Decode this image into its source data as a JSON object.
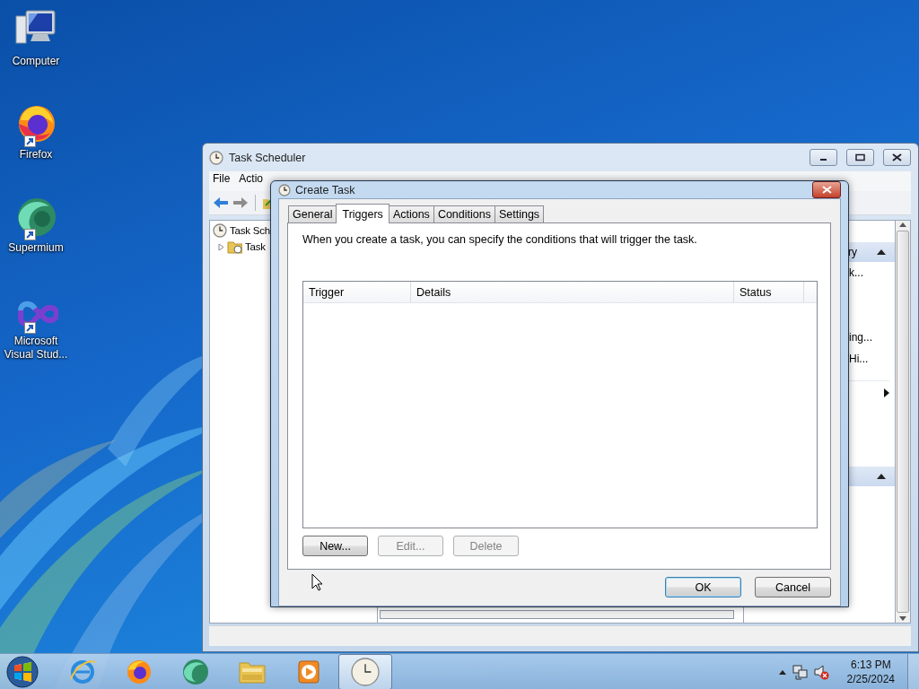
{
  "desktop_icons": [
    {
      "label": "Computer",
      "kind": "computer",
      "shortcut": false
    },
    {
      "label": "Firefox",
      "kind": "firefox",
      "shortcut": true
    },
    {
      "label": "Supermium",
      "kind": "supermium",
      "shortcut": true
    },
    {
      "label": "Microsoft Visual Stud...",
      "kind": "vs",
      "shortcut": true
    }
  ],
  "task_scheduler": {
    "title": "Task Scheduler",
    "menu": [
      {
        "label": "File"
      },
      {
        "label": "Actio"
      }
    ],
    "tree": [
      {
        "label": "Task Sch",
        "children": [
          {
            "label": "Task",
            "expanded": false
          }
        ]
      }
    ],
    "actions_pane": {
      "sections": [
        {
          "header": "ry",
          "expanded": true,
          "groups": [
            [
              "k..."
            ],
            [
              "ing...",
              "Hi..."
            ]
          ],
          "submenu": true
        },
        {
          "expanded": true
        }
      ]
    }
  },
  "dialog": {
    "title": "Create Task",
    "tabs": [
      {
        "label": "General",
        "selected": false
      },
      {
        "label": "Triggers",
        "selected": true
      },
      {
        "label": "Actions",
        "selected": false
      },
      {
        "label": "Conditions",
        "selected": false
      },
      {
        "label": "Settings",
        "selected": false
      }
    ],
    "description": "When you create a task, you can specify the conditions that will trigger the task.",
    "table": {
      "columns": [
        "Trigger",
        "Details",
        "Status"
      ]
    },
    "buttons": [
      {
        "label": "New...",
        "disabled": false
      },
      {
        "label": "Edit...",
        "disabled": true
      },
      {
        "label": "Delete",
        "disabled": true
      }
    ],
    "footer_buttons": [
      {
        "label": "OK",
        "default": true
      },
      {
        "label": "Cancel",
        "default": false
      }
    ]
  },
  "taskbar": {
    "apps": [
      {
        "kind": "ie",
        "active": false
      },
      {
        "kind": "firefox",
        "active": false
      },
      {
        "kind": "supermium",
        "active": false
      },
      {
        "kind": "explorer",
        "active": false
      },
      {
        "kind": "media",
        "active": false
      },
      {
        "kind": "clock",
        "active": true
      }
    ],
    "tray": [
      {
        "kind": "network"
      },
      {
        "kind": "volume",
        "muted": true
      }
    ],
    "clock": {
      "time": "6:13 PM",
      "date": "2/25/2024"
    }
  }
}
